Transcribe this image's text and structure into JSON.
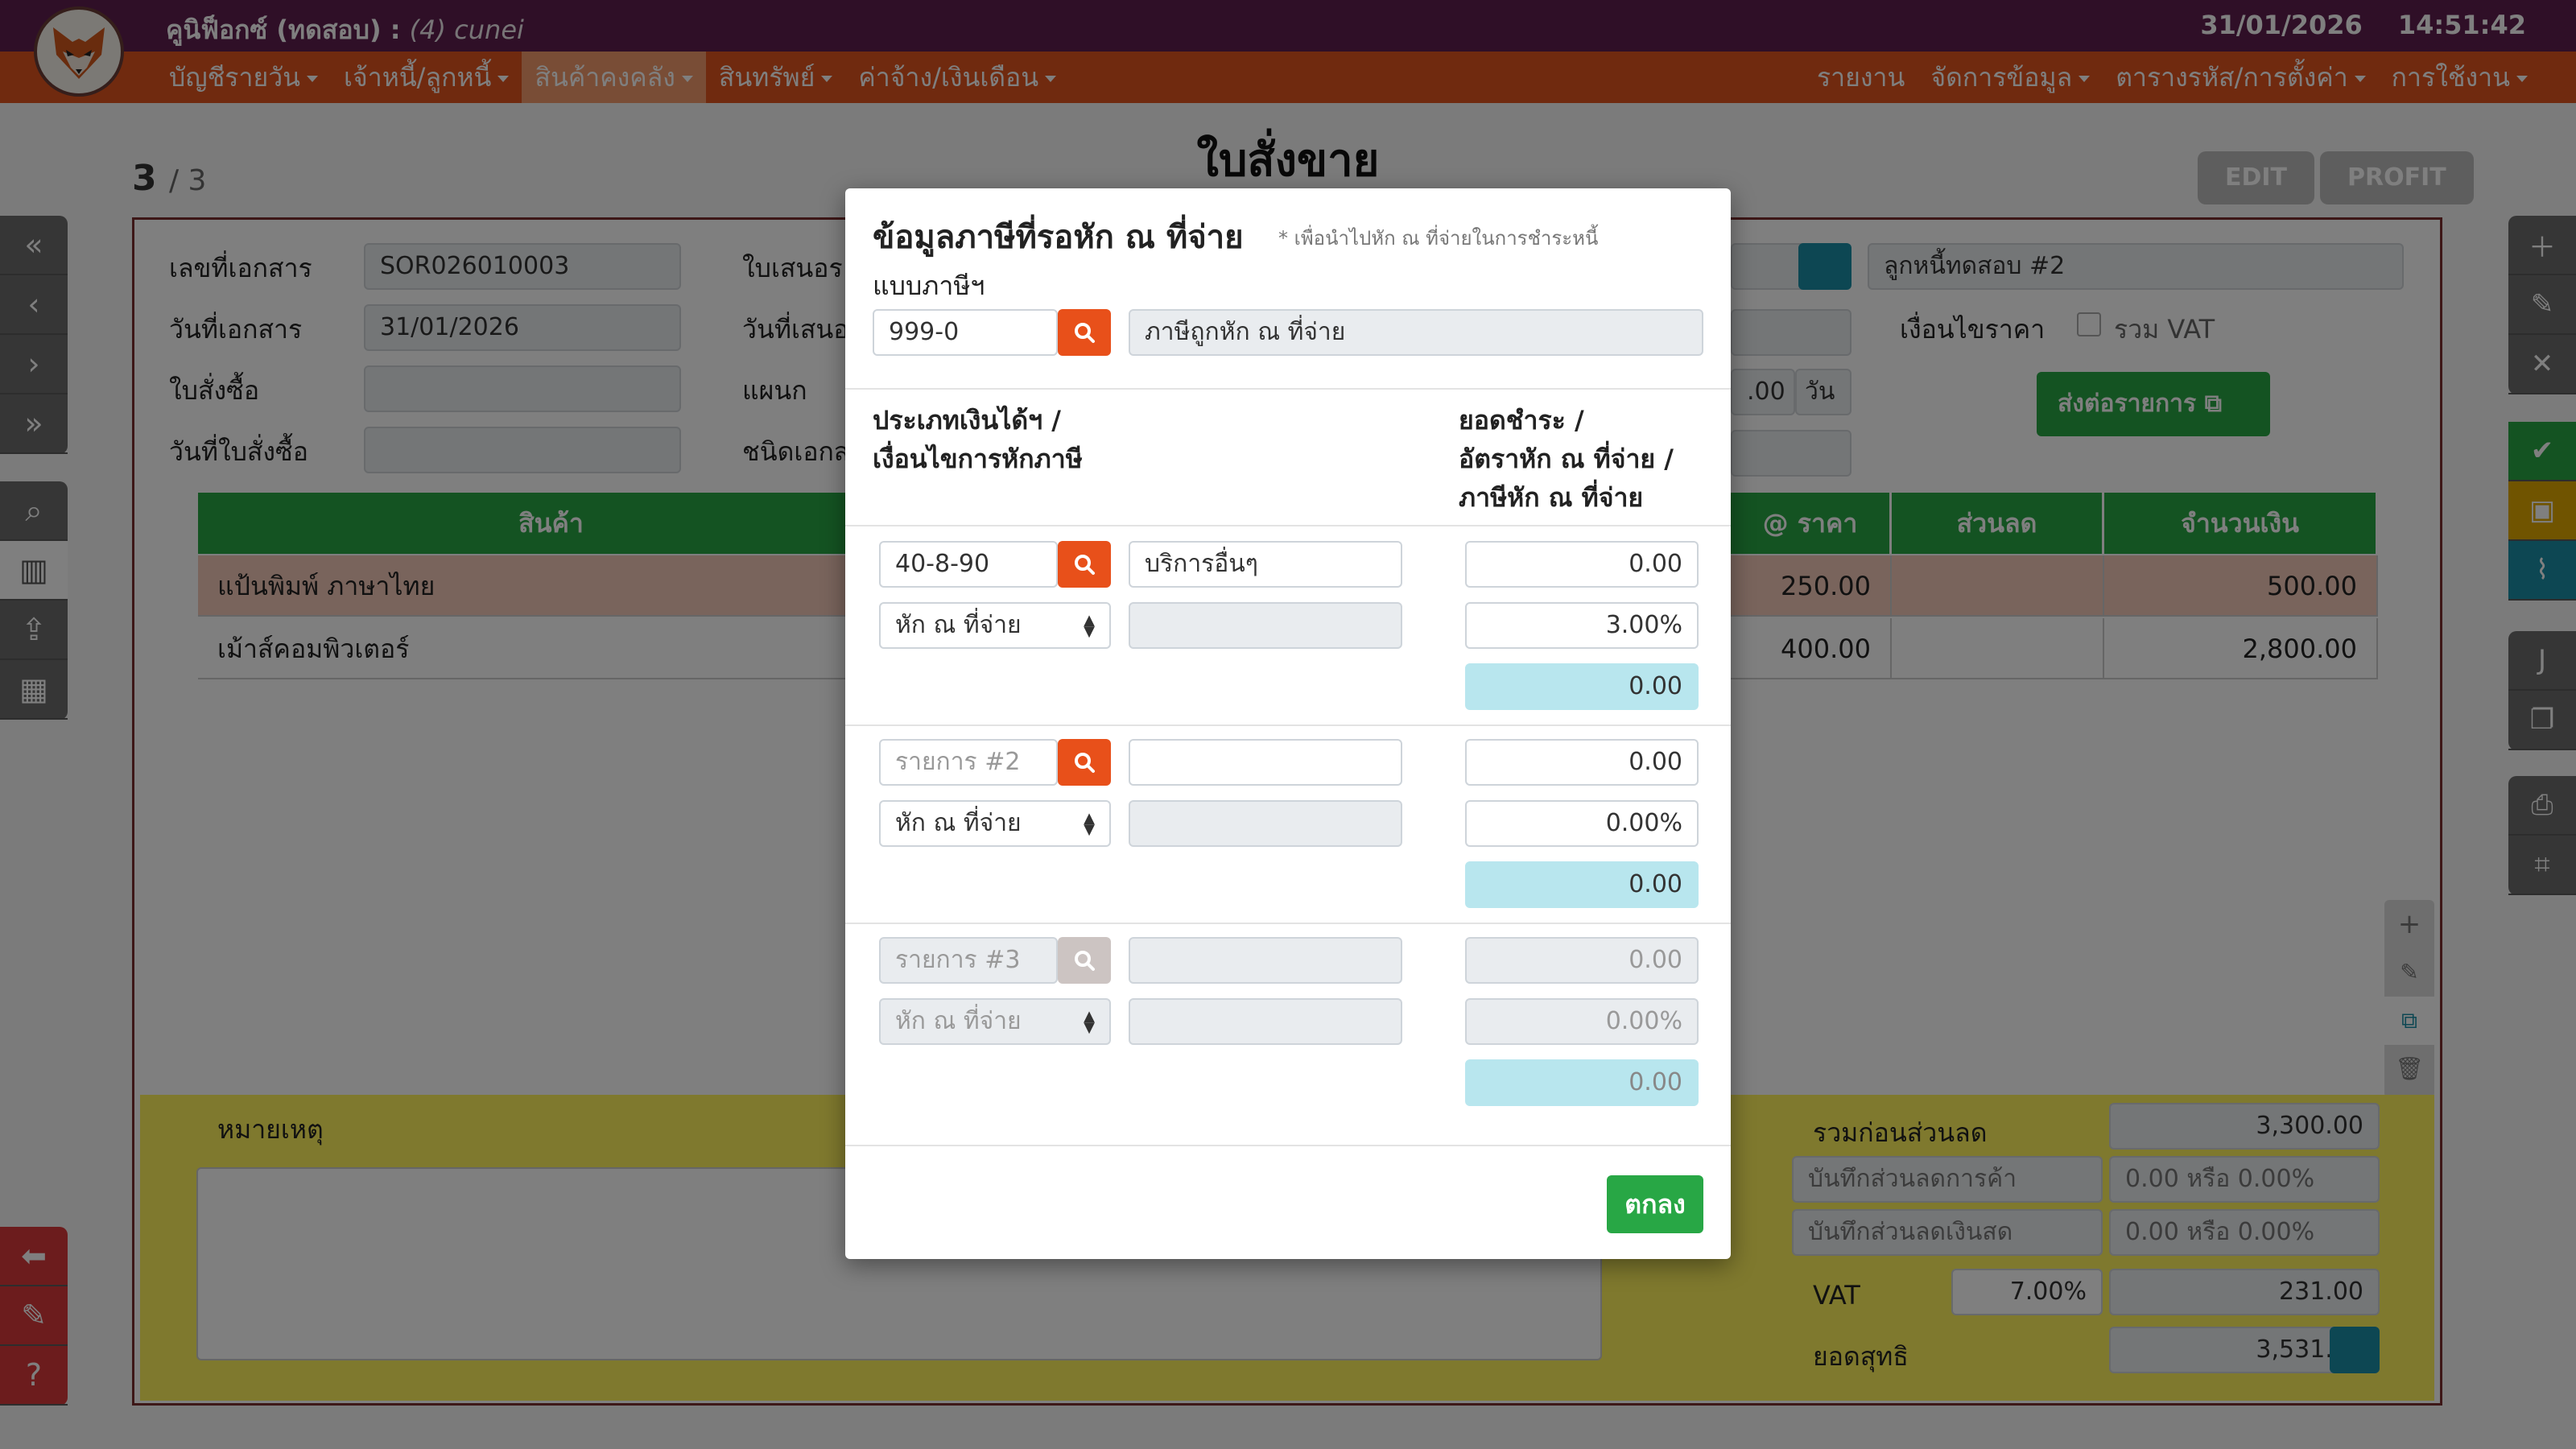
{
  "header": {
    "app_name": "คูนิฟ็อกซ์ (ทดสอบ)",
    "separator": " : ",
    "user": "(4) cunei",
    "date": "31/01/2026",
    "time": "14:51:42"
  },
  "menu_left": [
    {
      "label": "บัญชีรายวัน"
    },
    {
      "label": "เจ้าหนี้/ลูกหนี้"
    },
    {
      "label": "สินค้าคงคลัง"
    },
    {
      "label": "สินทรัพย์"
    },
    {
      "label": "ค่าจ้าง/เงินเดือน"
    }
  ],
  "menu_right": [
    {
      "label": "รายงาน"
    },
    {
      "label": "จัดการข้อมูล"
    },
    {
      "label": "ตารางรหัส/การตั้งค่า"
    },
    {
      "label": "การใช้งาน"
    }
  ],
  "page": {
    "title": "ใบสั่งขาย",
    "current": "3",
    "total": "/ 3",
    "edit_label": "EDIT",
    "profit_label": "PROFIT"
  },
  "form": {
    "doc_no_label": "เลขที่เอกสาร",
    "doc_no": "SOR026010003",
    "doc_date_label": "วันที่เอกสาร",
    "doc_date": "31/01/2026",
    "po_label": "ใบสั่งซื้อ",
    "po_date_label": "วันที่ใบสั่งซื้อ",
    "quote_label": "ใบเสนอร",
    "quote_date_label": "วันที่เสนอ",
    "dept_label": "แผนก",
    "doc_type_label": "ชนิดเอกส",
    "customer": "ลูกหนี้ทดสอบ #2",
    "price_cond_label": "เงื่อนไขราคา",
    "include_vat_label": "รวม VAT",
    "credit_days_value": ".00",
    "credit_days_unit": "วัน",
    "send_button": "ส่งต่อรายการ"
  },
  "table": {
    "headers": [
      "สินค้า",
      "@ ราคา",
      "ส่วนลด",
      "จำนวนเงิน"
    ],
    "rows": [
      {
        "product": "แป้นพิมพ์ ภาษาไทย",
        "price": "250.00",
        "discount": "",
        "amount": "500.00"
      },
      {
        "product": "เม้าส์คอมพิวเตอร์",
        "price": "400.00",
        "discount": "",
        "amount": "2,800.00"
      }
    ]
  },
  "summary": {
    "remark_label": "หมายเหตุ",
    "subtotal_label": "รวมก่อนส่วนลด",
    "subtotal": "3,300.00",
    "trade_discount_label": "บันทึกส่วนลดการค้า",
    "trade_discount": "0.00 หรือ 0.00%",
    "cash_discount_label": "บันทึกส่วนลดเงินสด",
    "cash_discount": "0.00 หรือ 0.00%",
    "vat_label": "VAT",
    "vat_rate": "7.00%",
    "vat_amount": "231.00",
    "net_label": "ยอดสุทธิ",
    "net": "3,531.00"
  },
  "modal": {
    "title": "ข้อมูลภาษีที่รอหัก ณ ที่จ่าย",
    "hint": "* เพื่อนำไปหัก ณ ที่จ่ายในการชำระหนี้",
    "form_type_label": "แบบภาษีฯ",
    "form_type_code": "999-0",
    "form_type_name": "ภาษีถูกหัก ณ ที่จ่าย",
    "col_left_line1": "ประเภทเงินได้ฯ /",
    "col_left_line2": "เงื่อนไขการหักภาษี",
    "col_right_line1": "ยอดชำระ /",
    "col_right_line2": "อัตราหัก ณ ที่จ่าย /",
    "col_right_line3": "ภาษีหัก ณ ที่จ่าย",
    "items": [
      {
        "code": "40-8-90",
        "placeholder": "",
        "name": "บริการอื่นๆ",
        "condition": "หัก ณ ที่จ่าย",
        "amount": "0.00",
        "rate": "3.00%",
        "tax": "0.00"
      },
      {
        "code": "",
        "placeholder": "รายการ #2",
        "name": "",
        "condition": "หัก ณ ที่จ่าย",
        "amount": "0.00",
        "rate": "0.00%",
        "tax": "0.00"
      },
      {
        "code": "",
        "placeholder": "รายการ #3",
        "name": "",
        "condition": "หัก ณ ที่จ่าย",
        "amount": "0.00",
        "rate": "0.00%",
        "tax": "0.00"
      }
    ],
    "ok_label": "ตกลง"
  },
  "colors": {
    "topbar": "#5e1f4f",
    "navbar": "#e0541f",
    "green": "#28a745",
    "yellow": "#fff35c",
    "search_btn": "#e8501a",
    "teal": "#1a8fa6"
  }
}
